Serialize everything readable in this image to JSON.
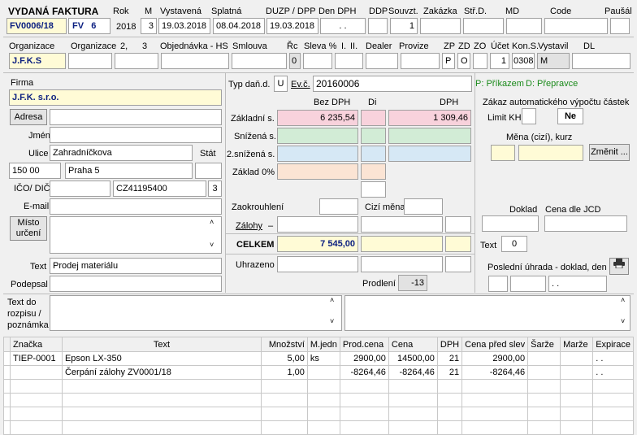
{
  "header": {
    "title": "VYDANÁ FAKTURA",
    "doc_no": "FV0006/18",
    "series": "FV",
    "series_no": "6",
    "labels": {
      "rok": "Rok",
      "m": "M",
      "vystavena": "Vystavená",
      "splatna": "Splatná",
      "duzp": "DUZP / DPP",
      "den_dph": "Den DPH",
      "ddp": "DDP",
      "souvzt": "Souvzt.",
      "zakazka": "Zakázka",
      "strd": "Stř.D.",
      "md": "MD",
      "code": "Code",
      "pausal": "Paušál"
    },
    "rok": "2018",
    "m": "3",
    "vystavena": "19.03.2018",
    "splatna": "08.04.2018",
    "duzp": "19.03.2018",
    "den_dph": ". .",
    "souvzt": "1"
  },
  "org": {
    "labels": {
      "org": "Organizace",
      "org2": "Organizace",
      "n2": "2,",
      "n3": "3",
      "objednavka": "Objednávka - HS",
      "smlouva": "Smlouva",
      "rc": "Řc",
      "sleva": "Sleva %",
      "i": "I.",
      "ii": "II.",
      "dealer": "Dealer",
      "provize": "Provize",
      "zp": "ZP",
      "zd": "ZD",
      "zo": "ZO",
      "ucet": "Účet",
      "kons": "Kon.S.",
      "vystavil": "Vystavil",
      "dl": "DL"
    },
    "org_value": "J.F.K.S",
    "rc": "0",
    "zp": "P",
    "zd": "O",
    "ucet": "1",
    "kons": "0308",
    "vystavil": "M"
  },
  "firma": {
    "label": "Firma",
    "value": "J.F.K. s.r.o.",
    "adresa_btn": "Adresa",
    "jmeno_label": "Jméno",
    "ulice_label": "Ulice",
    "ulice": "Zahradníčkova",
    "stat_label": "Stát",
    "psc": "150 00",
    "mesto": "Praha 5",
    "ico_label": "IČO/ DIČ",
    "dic": "CZ41195400",
    "dic_n": "3",
    "email_label": "E-mail",
    "misto_btn_1": "Místo",
    "misto_btn_2": "určení",
    "text_label": "Text",
    "text": "Prodej materiálu",
    "podpes_label": "Podepsal"
  },
  "tax": {
    "typ_label": "Typ daň.d.",
    "typ": "U",
    "ev_label": "Ev.č.",
    "ev": "20160006",
    "hint_p": "P: Příkazem",
    "hint_d": "D: Přepravce",
    "col_bez": "Bez DPH",
    "col_di": "Di",
    "col_dph": "DPH",
    "zakl": "Základní s.",
    "zakl_bez": "6 235,54",
    "zakl_dph": "1 309,46",
    "sniz": "Snížená s.",
    "sniz2": "2.snížená s.",
    "zakl0": "Základ 0%",
    "zaokr": "Zaokrouhlení",
    "cizi": "Cizí měna",
    "zalohy": "Zálohy",
    "zalohy_dash": "–",
    "celkem": "CELKEM",
    "celkem_val": "7 545,00",
    "uhrazeno": "Uhrazeno",
    "prodleni": "Prodlení",
    "prodleni_val": "-13"
  },
  "right": {
    "zakaz": "Zákaz automatického výpočtu částek",
    "limit": "Limit KH",
    "ne": "Ne",
    "mena": "Měna (cizí), kurz",
    "zmenit": "Změnit ...",
    "doklad": "Doklad",
    "cena_jcd": "Cena dle JCD",
    "text_label": "Text",
    "text_val": "0",
    "posl": "Poslední úhrada - doklad, den",
    "posl_date": ". ."
  },
  "note": {
    "l1": "Text do",
    "l2": "rozpisu /",
    "l3": "poznámka"
  },
  "table": {
    "headers": [
      "Značka",
      "Text",
      "Množství",
      "M.jedn",
      "Prod.cena",
      "Cena",
      "DPH",
      "Cena před slev",
      "Šarže",
      "Marže",
      "Expirace"
    ],
    "rows": [
      [
        "TIEP-0001",
        "Epson LX-350",
        "5,00",
        "ks",
        "2900,00",
        "14500,00",
        "21",
        "2900,00",
        "",
        "",
        ". ."
      ],
      [
        "",
        "Čerpání zálohy ZV0001/18",
        "1,00",
        "",
        "-8264,46",
        "-8264,46",
        "21",
        "-8264,46",
        "",
        "",
        ". ."
      ]
    ]
  },
  "colors": {
    "yellow": "#fffbd6",
    "pink": "#f8d2dc",
    "green": "#d2ecd6",
    "blue": "#d6e8f5",
    "peach": "#fbe4d4",
    "navy": "#0a1e80"
  },
  "icons": [
    "printer-icon",
    "scroll-up-icon",
    "scroll-down-icon"
  ]
}
